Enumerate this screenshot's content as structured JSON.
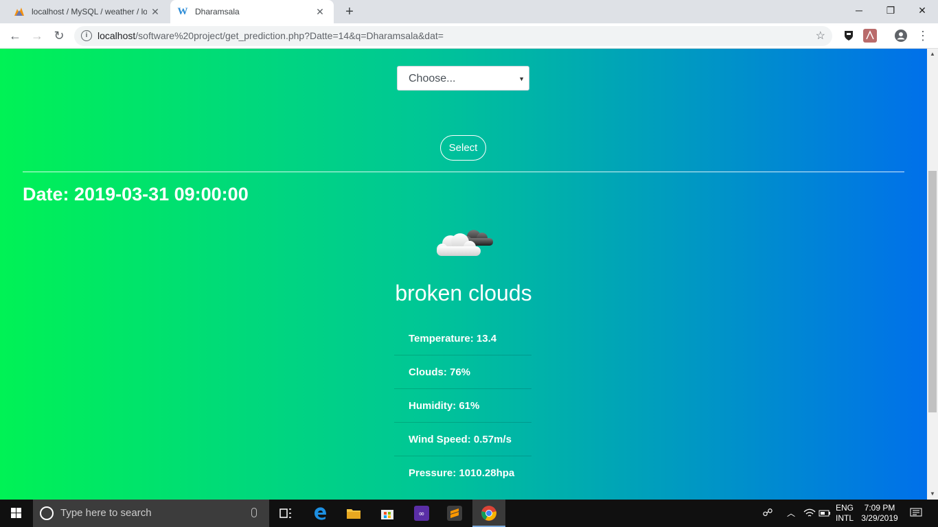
{
  "browser": {
    "tabs": [
      {
        "title": "localhost / MySQL / weather / lo",
        "favicon": "phpmyadmin-icon"
      },
      {
        "title": "Dharamsala",
        "favicon": "w-icon"
      }
    ],
    "url_host": "localhost",
    "url_path": "/software%20project/get_prediction.php?Datte=14&q=Dharamsala&dat="
  },
  "form": {
    "select_value": "Choose...",
    "select_button": "Select"
  },
  "weather": {
    "date_label": "Date: 2019-03-31 09:00:00",
    "description": "broken clouds",
    "icon": "broken-clouds-icon",
    "stats": [
      "Temperature: 13.4",
      "Clouds: 76%",
      "Humidity: 61%",
      "Wind Speed: 0.57m/s",
      "Pressure: 1010.28hpa"
    ]
  },
  "taskbar": {
    "search_placeholder": "Type here to search",
    "lang_line1": "ENG",
    "lang_line2": "INTL",
    "time": "7:09 PM",
    "date": "3/29/2019"
  },
  "colors": {
    "gradient_start": "#00f255",
    "gradient_mid": "#00c795",
    "gradient_end": "#0070ea"
  }
}
